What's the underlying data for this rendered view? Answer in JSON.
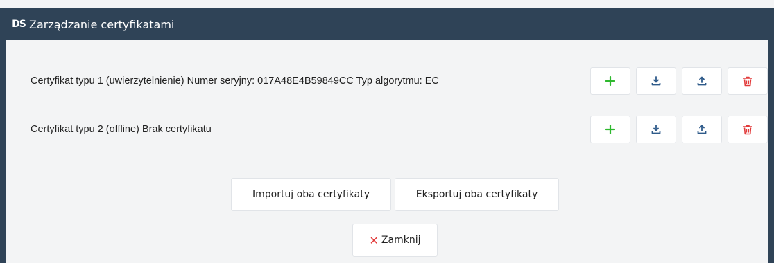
{
  "dialog": {
    "logo_text": "DS",
    "title": "Zarządzanie certyfikatami"
  },
  "certificates": [
    {
      "label": "Certyfikat typu 1 (uwierzytelnienie) Numer seryjny: 017A48E4B59849CC Typ algorytmu: EC",
      "actions": [
        "plus-icon",
        "download-icon",
        "upload-icon",
        "trash-icon"
      ]
    },
    {
      "label": "Certyfikat typu 2 (offline) Brak certyfikatu",
      "actions": [
        "plus-icon",
        "download-icon",
        "upload-icon",
        "trash-icon"
      ]
    }
  ],
  "footer": {
    "import_both_label": "Importuj oba certyfikaty",
    "export_both_label": "Eksportuj oba certyfikaty",
    "close_label": "Zamknij",
    "close_icon": "close-icon"
  },
  "colors": {
    "titlebar": "#2f4357",
    "add": "#2eb82e",
    "blue_icon": "#2f5b8a",
    "delete": "#e23b3b"
  }
}
